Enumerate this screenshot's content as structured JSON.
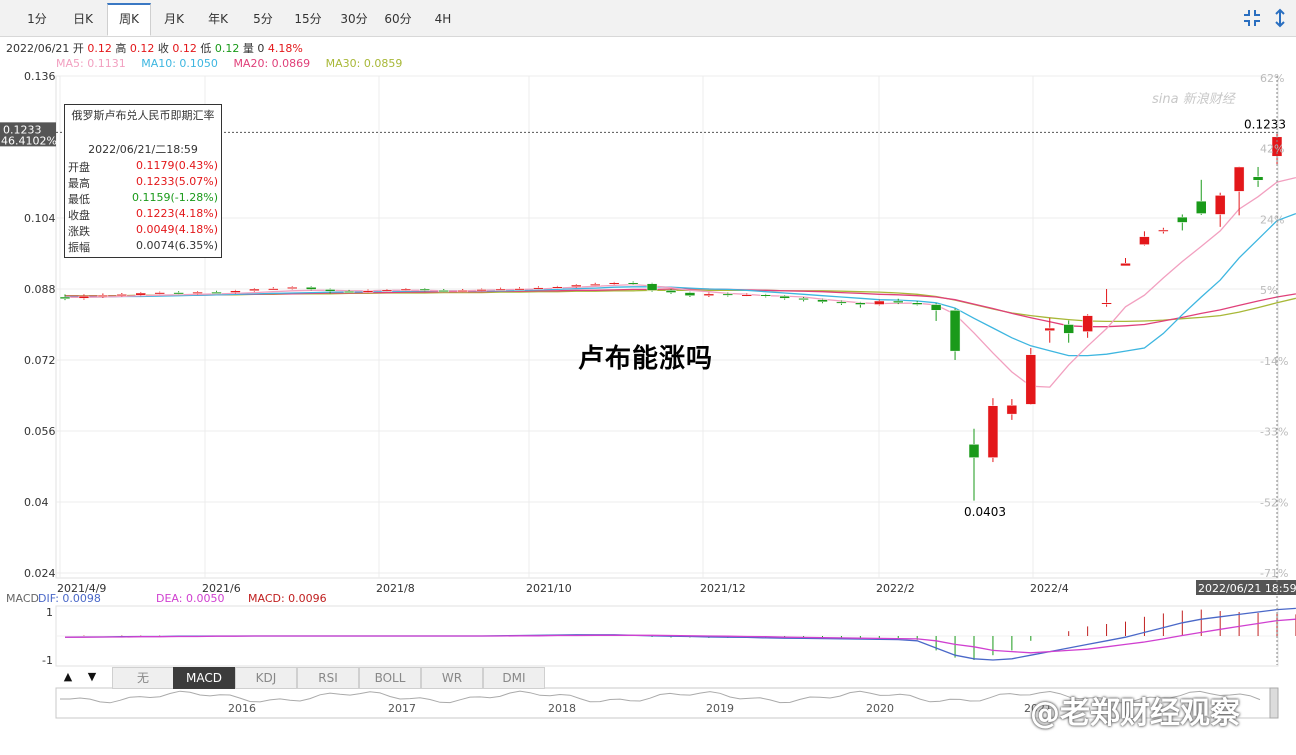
{
  "tabs": [
    {
      "label": "1分",
      "active": false
    },
    {
      "label": "日K",
      "active": false
    },
    {
      "label": "周K",
      "active": true
    },
    {
      "label": "月K",
      "active": false
    },
    {
      "label": "年K",
      "active": false
    },
    {
      "label": "5分",
      "active": false
    },
    {
      "label": "15分",
      "active": false
    },
    {
      "label": "30分",
      "active": false
    },
    {
      "label": "60分",
      "active": false
    },
    {
      "label": "4H",
      "active": false
    }
  ],
  "toolbar": {
    "fit_icon": "compress-icon",
    "expand_icon": "expand-icon"
  },
  "info_line": {
    "date": "2022/06/21",
    "open_label": "开",
    "open": "0.12",
    "high_label": "高",
    "high": "0.12",
    "close_label": "收",
    "close": "0.12",
    "low_label": "低",
    "low": "0.12",
    "vol_label": "量",
    "vol": "0",
    "change": "4.18%"
  },
  "ma_legend": {
    "ma5": "MA5: 0.1131",
    "ma10": "MA10: 0.1050",
    "ma20": "MA20: 0.0869",
    "ma30": "MA30: 0.0859"
  },
  "colors": {
    "up": "#e3171a",
    "down": "#1a9a1a",
    "ma5": "#f2a0c0",
    "ma10": "#3db6e0",
    "ma20": "#e0407a",
    "ma30": "#a8b838",
    "dif": "#4a68c8",
    "dea": "#d040d0",
    "macd": "#c02020"
  },
  "tooltip": {
    "title": "俄罗斯卢布兑人民币即期汇率",
    "datetime": "2022/06/21/二18:59",
    "rows": [
      {
        "k": "开盘",
        "v": "0.1179(0.43%)",
        "dir": "up"
      },
      {
        "k": "最高",
        "v": "0.1233(5.07%)",
        "dir": "up"
      },
      {
        "k": "最低",
        "v": "0.1159(-1.28%)",
        "dir": "down"
      },
      {
        "k": "收盘",
        "v": "0.1223(4.18%)",
        "dir": "up"
      },
      {
        "k": "涨跌",
        "v": "0.0049(4.18%)",
        "dir": "up"
      },
      {
        "k": "振幅",
        "v": "0.0074(6.35%)",
        "dir": "flat"
      }
    ]
  },
  "price_box": {
    "price": "0.1233",
    "pct": "46.4102%"
  },
  "time_box": "2022/06/21 18:59",
  "max_label": "0.1233",
  "min_label": "0.0403",
  "overlay_title": "卢布能涨吗",
  "watermark": "@老郑财经观察",
  "sina_logo": "sina 新浪财经",
  "macd_legend": {
    "name": "MACD",
    "dif": "DIF: 0.0098",
    "dea": "DEA: 0.0050",
    "macd": "MACD: 0.0096"
  },
  "macd_axis": [
    "1",
    "-1"
  ],
  "indicator_tabs": [
    {
      "label": "无",
      "active": false
    },
    {
      "label": "MACD",
      "active": true
    },
    {
      "label": "KDJ",
      "active": false
    },
    {
      "label": "RSI",
      "active": false
    },
    {
      "label": "BOLL",
      "active": false
    },
    {
      "label": "WR",
      "active": false
    },
    {
      "label": "DMI",
      "active": false
    }
  ],
  "nav_buttons": {
    "up": "▲",
    "down": "▼"
  },
  "navigator_years": [
    "2016",
    "2017",
    "2018",
    "2019",
    "2020",
    "2021"
  ],
  "chart_data": {
    "type": "candlestick",
    "title": "俄罗斯卢布兑人民币即期汇率",
    "y_ticks": [
      "0.136",
      "0.104",
      "0.088",
      "0.072",
      "0.056",
      "0.04",
      "0.024"
    ],
    "pct_ticks": [
      "62%",
      "42%",
      "24%",
      "5%",
      "-14%",
      "-33%",
      "-52%",
      "-71%"
    ],
    "x_labels": [
      "2021/4/9",
      "2021/6",
      "2021/8",
      "2021/10",
      "2021/12",
      "2022/2",
      "2022/4"
    ],
    "ylim": [
      0.024,
      0.136
    ],
    "candles": [
      [
        0.0862,
        0.0858,
        0.0868,
        0.0855
      ],
      [
        0.0859,
        0.0864,
        0.0868,
        0.0856
      ],
      [
        0.0864,
        0.0866,
        0.087,
        0.086
      ],
      [
        0.0866,
        0.0868,
        0.0871,
        0.0863
      ],
      [
        0.0866,
        0.0871,
        0.0873,
        0.0864
      ],
      [
        0.0871,
        0.0872,
        0.0874,
        0.0868
      ],
      [
        0.0872,
        0.087,
        0.0875,
        0.0868
      ],
      [
        0.087,
        0.0873,
        0.0875,
        0.0868
      ],
      [
        0.0873,
        0.0872,
        0.0876,
        0.087
      ],
      [
        0.0872,
        0.0876,
        0.0878,
        0.087
      ],
      [
        0.0876,
        0.088,
        0.0882,
        0.0874
      ],
      [
        0.088,
        0.0881,
        0.0884,
        0.0878
      ],
      [
        0.0881,
        0.0884,
        0.0886,
        0.0879
      ],
      [
        0.0884,
        0.0879,
        0.0886,
        0.0877
      ],
      [
        0.0879,
        0.0875,
        0.0881,
        0.087
      ],
      [
        0.0875,
        0.0874,
        0.0878,
        0.0872
      ],
      [
        0.0874,
        0.0876,
        0.0879,
        0.0871
      ],
      [
        0.0876,
        0.0878,
        0.088,
        0.0874
      ],
      [
        0.0878,
        0.088,
        0.0882,
        0.0876
      ],
      [
        0.088,
        0.0877,
        0.0882,
        0.0875
      ],
      [
        0.0877,
        0.0875,
        0.088,
        0.0873
      ],
      [
        0.0875,
        0.0877,
        0.088,
        0.0873
      ],
      [
        0.0877,
        0.0879,
        0.0881,
        0.0875
      ],
      [
        0.0879,
        0.088,
        0.0883,
        0.0877
      ],
      [
        0.088,
        0.0881,
        0.0884,
        0.0878
      ],
      [
        0.0881,
        0.0883,
        0.0886,
        0.0879
      ],
      [
        0.0883,
        0.0885,
        0.0887,
        0.0881
      ],
      [
        0.0885,
        0.0889,
        0.0891,
        0.0883
      ],
      [
        0.0889,
        0.0891,
        0.0894,
        0.0887
      ],
      [
        0.0891,
        0.0894,
        0.0896,
        0.0889
      ],
      [
        0.0894,
        0.0892,
        0.0897,
        0.0889
      ],
      [
        0.0892,
        0.0877,
        0.0894,
        0.0874
      ],
      [
        0.0877,
        0.0872,
        0.088,
        0.0869
      ],
      [
        0.0872,
        0.0865,
        0.0874,
        0.0862
      ],
      [
        0.0865,
        0.0869,
        0.0872,
        0.0862
      ],
      [
        0.0869,
        0.0866,
        0.0872,
        0.0863
      ],
      [
        0.0866,
        0.0867,
        0.087,
        0.0863
      ],
      [
        0.0867,
        0.0864,
        0.0869,
        0.0861
      ],
      [
        0.0864,
        0.0859,
        0.0866,
        0.0856
      ],
      [
        0.0859,
        0.0856,
        0.0862,
        0.0852
      ],
      [
        0.0856,
        0.0851,
        0.0858,
        0.0848
      ],
      [
        0.0851,
        0.0849,
        0.0854,
        0.0844
      ],
      [
        0.0849,
        0.0845,
        0.0851,
        0.0838
      ],
      [
        0.0845,
        0.0853,
        0.0856,
        0.0843
      ],
      [
        0.0853,
        0.0849,
        0.0858,
        0.0846
      ],
      [
        0.0849,
        0.0845,
        0.0853,
        0.0843
      ],
      [
        0.0845,
        0.0832,
        0.0848,
        0.0808
      ],
      [
        0.0832,
        0.074,
        0.0836,
        0.072
      ],
      [
        0.053,
        0.05,
        0.0565,
        0.0403
      ],
      [
        0.05,
        0.0617,
        0.0634,
        0.049
      ],
      [
        0.0598,
        0.0618,
        0.0632,
        0.0585
      ],
      [
        0.062,
        0.0732,
        0.0747,
        0.0619
      ],
      [
        0.0786,
        0.0792,
        0.0815,
        0.0759
      ],
      [
        0.08,
        0.078,
        0.0809,
        0.0759
      ],
      [
        0.0784,
        0.082,
        0.0823,
        0.077
      ],
      [
        0.0849,
        0.0849,
        0.088,
        0.084
      ],
      [
        0.0932,
        0.0938,
        0.095,
        0.0936
      ],
      [
        0.098,
        0.0998,
        0.101,
        0.0978
      ],
      [
        0.101,
        0.1013,
        0.1018,
        0.1005
      ],
      [
        0.1042,
        0.103,
        0.1048,
        0.1012
      ],
      [
        0.1078,
        0.105,
        0.1126,
        0.1047
      ],
      [
        0.1048,
        0.1091,
        0.1097,
        0.102
      ],
      [
        0.11,
        0.1155,
        0.1156,
        0.1046
      ],
      [
        0.1133,
        0.1125,
        0.1155,
        0.111
      ],
      [
        0.1179,
        0.1223,
        0.1233,
        0.1159
      ]
    ],
    "ma5": [
      0.0861,
      0.0861,
      0.0862,
      0.0863,
      0.0865,
      0.0866,
      0.0867,
      0.0868,
      0.0869,
      0.087,
      0.0872,
      0.0874,
      0.0876,
      0.0877,
      0.0877,
      0.0876,
      0.0876,
      0.0877,
      0.0877,
      0.0877,
      0.0876,
      0.0876,
      0.0877,
      0.0878,
      0.0879,
      0.088,
      0.0882,
      0.0884,
      0.0886,
      0.0888,
      0.089,
      0.0887,
      0.0883,
      0.0877,
      0.0874,
      0.087,
      0.0868,
      0.0865,
      0.0864,
      0.0862,
      0.0857,
      0.0853,
      0.0849,
      0.0847,
      0.0848,
      0.0848,
      0.0844,
      0.0823,
      0.0781,
      0.0736,
      0.0693,
      0.0661,
      0.0659,
      0.0709,
      0.0751,
      0.0791,
      0.084,
      0.0866,
      0.0905,
      0.0942,
      0.0976,
      0.1011,
      0.106,
      0.1088,
      0.1121,
      0.1131
    ],
    "ma10": [
      0.0862,
      0.0862,
      0.0862,
      0.0863,
      0.0863,
      0.0864,
      0.0865,
      0.0866,
      0.0867,
      0.0868,
      0.0869,
      0.087,
      0.0871,
      0.0872,
      0.0873,
      0.0873,
      0.0874,
      0.0875,
      0.0875,
      0.0876,
      0.0876,
      0.0876,
      0.0876,
      0.0876,
      0.0877,
      0.0878,
      0.0879,
      0.0881,
      0.0882,
      0.0884,
      0.0885,
      0.0885,
      0.0884,
      0.0882,
      0.088,
      0.0879,
      0.0877,
      0.0874,
      0.0871,
      0.0868,
      0.0865,
      0.0862,
      0.0859,
      0.0856,
      0.0855,
      0.0853,
      0.0849,
      0.0837,
      0.0814,
      0.0792,
      0.077,
      0.0752,
      0.0741,
      0.073,
      0.073,
      0.0733,
      0.074,
      0.0747,
      0.078,
      0.0822,
      0.0862,
      0.09,
      0.095,
      0.0992,
      0.1034,
      0.105
    ],
    "ma20": [
      0.0864,
      0.0864,
      0.0864,
      0.0864,
      0.0865,
      0.0865,
      0.0866,
      0.0866,
      0.0867,
      0.0868,
      0.0868,
      0.0869,
      0.0869,
      0.087,
      0.0871,
      0.0871,
      0.0872,
      0.0872,
      0.0873,
      0.0873,
      0.0874,
      0.0874,
      0.0874,
      0.0875,
      0.0875,
      0.0876,
      0.0876,
      0.0877,
      0.0877,
      0.0878,
      0.0879,
      0.0879,
      0.088,
      0.088,
      0.088,
      0.0879,
      0.0878,
      0.0877,
      0.0876,
      0.0875,
      0.0874,
      0.0872,
      0.087,
      0.0868,
      0.0867,
      0.0865,
      0.0862,
      0.0856,
      0.0846,
      0.0836,
      0.0825,
      0.0815,
      0.0806,
      0.0797,
      0.0795,
      0.0795,
      0.0797,
      0.08,
      0.0808,
      0.0816,
      0.0825,
      0.0833,
      0.0843,
      0.0853,
      0.0862,
      0.0869
    ],
    "ma30": [
      0.0865,
      0.0865,
      0.0865,
      0.0865,
      0.0866,
      0.0866,
      0.0866,
      0.0867,
      0.0867,
      0.0867,
      0.0868,
      0.0868,
      0.0869,
      0.0869,
      0.0869,
      0.087,
      0.087,
      0.0871,
      0.0871,
      0.0871,
      0.0872,
      0.0872,
      0.0872,
      0.0873,
      0.0873,
      0.0874,
      0.0874,
      0.0875,
      0.0875,
      0.0876,
      0.0876,
      0.0877,
      0.0877,
      0.0877,
      0.0877,
      0.0877,
      0.0877,
      0.0877,
      0.0876,
      0.0876,
      0.0876,
      0.0875,
      0.0874,
      0.0873,
      0.0871,
      0.0868,
      0.0863,
      0.0855,
      0.0845,
      0.0835,
      0.0826,
      0.082,
      0.0815,
      0.0811,
      0.0808,
      0.0807,
      0.0807,
      0.0808,
      0.081,
      0.0813,
      0.0816,
      0.082,
      0.0828,
      0.0838,
      0.0849,
      0.0859
    ],
    "macd_ylim": [
      -1.25,
      1.25
    ],
    "dif": [
      -0.05,
      -0.04,
      -0.04,
      -0.03,
      -0.02,
      -0.02,
      -0.01,
      -0.01,
      0.0,
      0.0,
      0.0,
      0.0,
      0.0,
      0.0,
      0.0,
      0.0,
      0.0,
      0.0,
      0.0,
      0.0,
      0.0,
      0.0,
      0.0,
      0.01,
      0.02,
      0.03,
      0.04,
      0.05,
      0.05,
      0.05,
      0.03,
      0.01,
      -0.01,
      -0.02,
      -0.04,
      -0.05,
      -0.06,
      -0.08,
      -0.09,
      -0.1,
      -0.11,
      -0.12,
      -0.13,
      -0.14,
      -0.15,
      -0.2,
      -0.5,
      -0.8,
      -0.95,
      -1.0,
      -0.95,
      -0.8,
      -0.65,
      -0.5,
      -0.35,
      -0.2,
      -0.05,
      0.15,
      0.35,
      0.55,
      0.7,
      0.8,
      0.9,
      1.0,
      1.1,
      1.15
    ],
    "dea": [
      -0.05,
      -0.05,
      -0.04,
      -0.04,
      -0.03,
      -0.03,
      -0.02,
      -0.02,
      -0.01,
      -0.01,
      0.0,
      0.0,
      0.0,
      0.0,
      0.0,
      0.0,
      0.0,
      0.0,
      0.0,
      0.0,
      0.0,
      0.0,
      0.0,
      0.0,
      0.01,
      0.01,
      0.02,
      0.02,
      0.03,
      0.03,
      0.03,
      0.03,
      0.02,
      0.01,
      0.0,
      -0.01,
      -0.02,
      -0.03,
      -0.05,
      -0.06,
      -0.07,
      -0.08,
      -0.09,
      -0.1,
      -0.11,
      -0.12,
      -0.2,
      -0.35,
      -0.45,
      -0.6,
      -0.65,
      -0.7,
      -0.65,
      -0.6,
      -0.55,
      -0.45,
      -0.35,
      -0.25,
      -0.12,
      0.02,
      0.15,
      0.28,
      0.4,
      0.52,
      0.64,
      0.7
    ],
    "macd": [
      0.0,
      0.02,
      0.0,
      0.02,
      0.02,
      0.02,
      0.02,
      0.02,
      0.02,
      0.02,
      0.0,
      0.0,
      0.0,
      0.0,
      0.0,
      0.0,
      0.0,
      0.0,
      0.0,
      0.0,
      0.0,
      0.0,
      0.0,
      0.02,
      0.02,
      0.04,
      0.04,
      0.06,
      0.04,
      0.04,
      0.0,
      -0.04,
      -0.06,
      -0.06,
      -0.08,
      -0.08,
      -0.08,
      -0.1,
      -0.08,
      -0.08,
      -0.08,
      -0.08,
      -0.08,
      -0.08,
      -0.08,
      -0.16,
      -0.6,
      -0.9,
      -1.0,
      -0.8,
      -0.6,
      -0.2,
      0.0,
      0.2,
      0.4,
      0.5,
      0.6,
      0.8,
      0.94,
      1.06,
      1.1,
      1.04,
      1.0,
      0.96,
      0.92,
      0.9
    ]
  }
}
